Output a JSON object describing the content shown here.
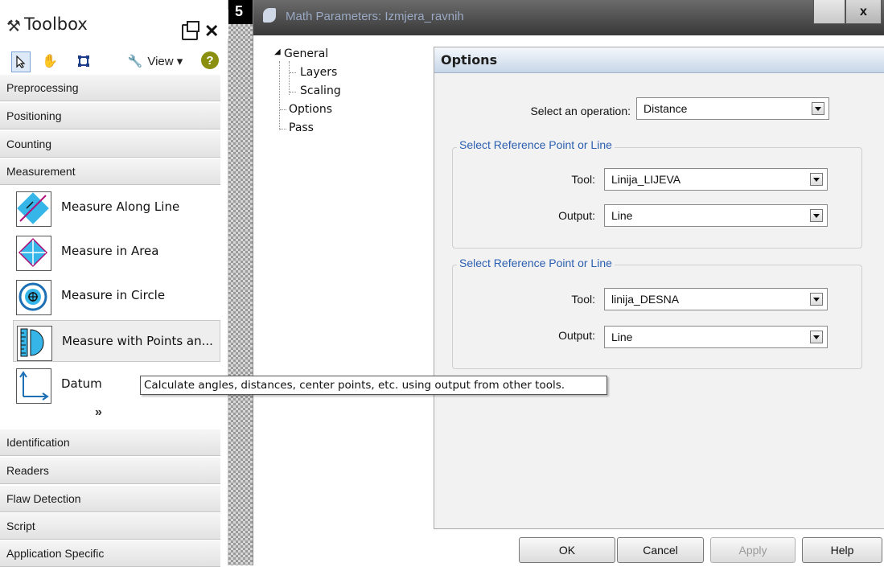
{
  "toolbox": {
    "title": "Toolbox",
    "tools": {
      "pointer": "pointer-icon",
      "pan": "hand-icon",
      "select": "crop-icon",
      "view_label": "View ▾",
      "help": "?"
    },
    "categories_top": [
      "Preprocessing",
      "Positioning",
      "Counting",
      "Measurement"
    ],
    "measurement_tools": [
      {
        "label": "Measure Along Line",
        "icon": "measure-line-icon"
      },
      {
        "label": "Measure in Area",
        "icon": "measure-area-icon"
      },
      {
        "label": "Measure in Circle",
        "icon": "measure-circle-icon"
      },
      {
        "label": "Measure with Points an...",
        "icon": "measure-points-icon"
      },
      {
        "label": "Datum",
        "icon": "datum-icon"
      }
    ],
    "more": "»",
    "categories_bottom": [
      "Identification",
      "Readers",
      "Flaw Detection",
      "Script",
      "Application Specific"
    ]
  },
  "dialog": {
    "title": "Math Parameters: Izmjera_ravnih",
    "close": "x",
    "tree": {
      "general": "General",
      "layers": "Layers",
      "scaling": "Scaling",
      "options": "Options",
      "pass": "Pass"
    },
    "options": {
      "header": "Options",
      "operation_label": "Select an operation:",
      "operation_value": "Distance",
      "group1": {
        "title": "Select Reference Point or Line",
        "tool_label": "Tool:",
        "tool_value": "Linija_LIJEVA",
        "output_label": "Output:",
        "output_value": "Line"
      },
      "group2": {
        "title": "Select Reference Point or Line",
        "tool_label": "Tool:",
        "tool_value": "linija_DESNA",
        "output_label": "Output:",
        "output_value": "Line"
      }
    },
    "buttons": {
      "ok": "OK",
      "cancel": "Cancel",
      "apply": "Apply",
      "help": "Help"
    }
  },
  "tooltip": "Calculate angles, distances, center points, etc. using output from other tools."
}
